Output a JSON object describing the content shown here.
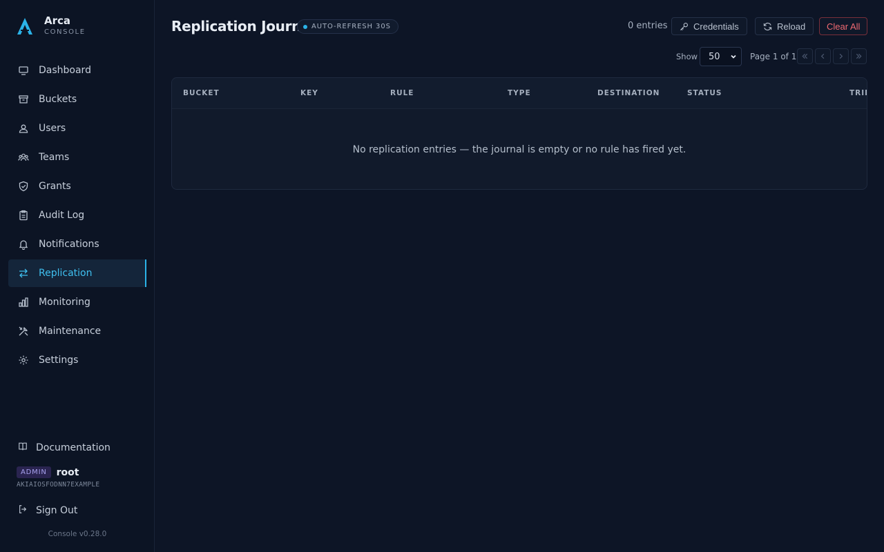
{
  "app": {
    "name": "Arca",
    "subtitle": "CONSOLE"
  },
  "sidebar": {
    "items": [
      {
        "label": "Dashboard",
        "icon": "monitor-icon",
        "active": false
      },
      {
        "label": "Buckets",
        "icon": "archive-box-icon",
        "active": false
      },
      {
        "label": "Users",
        "icon": "user-icon",
        "active": false
      },
      {
        "label": "Teams",
        "icon": "team-icon",
        "active": false
      },
      {
        "label": "Grants",
        "icon": "shield-icon",
        "active": false
      },
      {
        "label": "Audit Log",
        "icon": "clipboard-icon",
        "active": false
      },
      {
        "label": "Notifications",
        "icon": "bell-icon",
        "active": false
      },
      {
        "label": "Replication",
        "icon": "arrows-swap-icon",
        "active": true
      },
      {
        "label": "Monitoring",
        "icon": "bar-chart-icon",
        "active": false
      },
      {
        "label": "Maintenance",
        "icon": "tools-icon",
        "active": false
      },
      {
        "label": "Settings",
        "icon": "gear-icon",
        "active": false
      }
    ],
    "documentation": "Documentation",
    "user": {
      "role": "ADMIN",
      "name": "root",
      "access_key": "AKIAIOSFODNN7EXAMPLE"
    },
    "sign_out": "Sign Out",
    "version": "Console v0.28.0"
  },
  "header": {
    "title": "Replication Journal",
    "refresh_badge": "AUTO-REFRESH 30S",
    "entries": "0 entries",
    "credentials_label": "Credentials",
    "reload_label": "Reload",
    "clear_label": "Clear All"
  },
  "pagination": {
    "show_label": "Show",
    "page_size": "50",
    "page_info": "Page 1 of 1"
  },
  "table": {
    "columns": [
      "BUCKET",
      "KEY",
      "RULE",
      "TYPE",
      "DESTINATION",
      "STATUS",
      "TRIES"
    ],
    "empty_message": "No replication entries — the journal is empty or no rule has fired yet."
  },
  "colors": {
    "accent": "#2bb3e8",
    "danger": "#f06a72",
    "background": "#0d1526"
  }
}
